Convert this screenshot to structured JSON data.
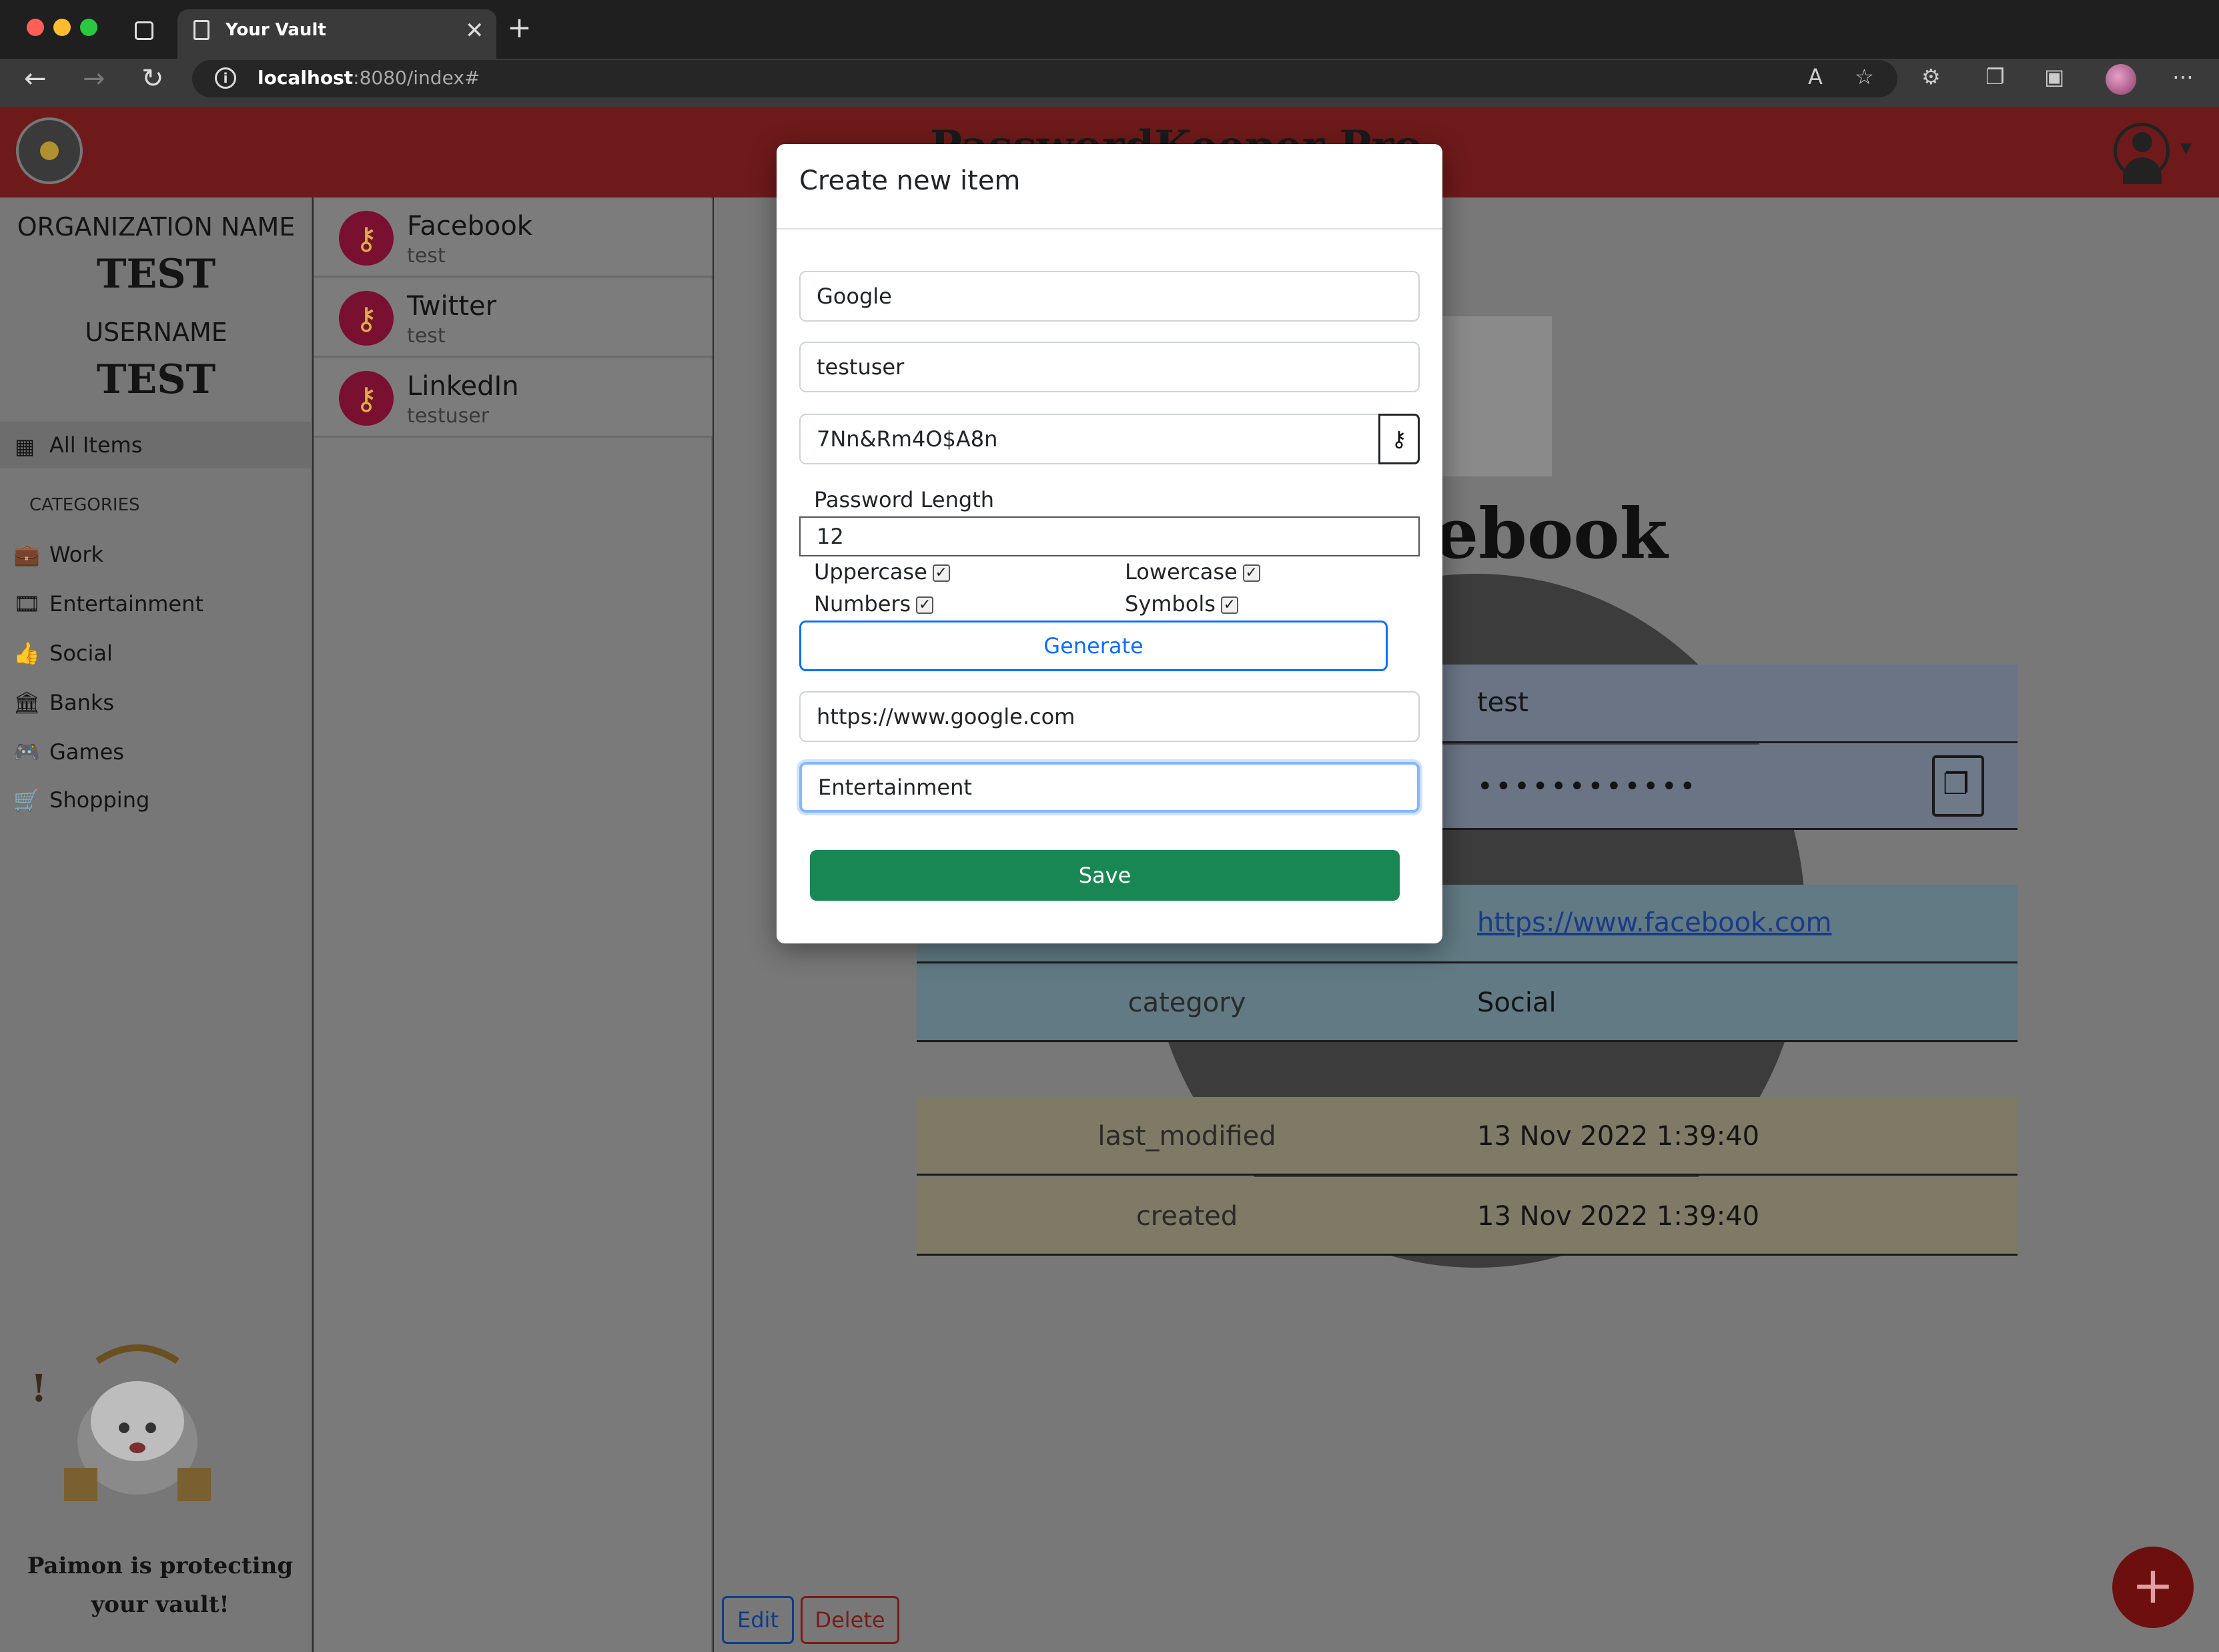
{
  "browser": {
    "tab_title": "Your Vault",
    "url_host": "localhost",
    "url_rest": ":8080/index#"
  },
  "app": {
    "brand": "PasswordKeeper Pro",
    "icons": {
      "logo": "vault-logo",
      "user": "user-circle-icon"
    }
  },
  "sidebar": {
    "org_label": "ORGANIZATION NAME",
    "org_value": "TEST",
    "user_label": "USERNAME",
    "user_value": "TEST",
    "all_items": "All Items",
    "categories_heading": "CATEGORIES",
    "categories": [
      {
        "label": "Work",
        "icon": "briefcase-icon",
        "glyph": "💼"
      },
      {
        "label": "Entertainment",
        "icon": "film-icon",
        "glyph": "🎞"
      },
      {
        "label": "Social",
        "icon": "thumbs-up-icon",
        "glyph": "👍"
      },
      {
        "label": "Banks",
        "icon": "bank-icon",
        "glyph": "🏛"
      },
      {
        "label": "Games",
        "icon": "gamepad-icon",
        "glyph": "🎮"
      },
      {
        "label": "Shopping",
        "icon": "cart-icon",
        "glyph": "🛒"
      }
    ],
    "caption_line1": "Paimon is protecting",
    "caption_line2": "your vault!"
  },
  "items": [
    {
      "name": "Facebook",
      "user": "test"
    },
    {
      "name": "Twitter",
      "user": "test"
    },
    {
      "name": "LinkedIn",
      "user": "testuser"
    }
  ],
  "details": {
    "title": "ebook",
    "username_value": "test",
    "password_value": "••••••••••••",
    "url_value": "https://www.facebook.com",
    "category_key": "category",
    "category_value": "Social",
    "last_modified_key": "last_modified",
    "last_modified_value": "13 Nov 2022 1:39:40",
    "created_key": "created",
    "created_value": "13 Nov 2022 1:39:40",
    "edit_label": "Edit",
    "delete_label": "Delete",
    "fab_label": "+"
  },
  "modal": {
    "title": "Create new item",
    "name_value": "Google",
    "username_value": "testuser",
    "password_value": "7Nn&Rm4O$A8n",
    "password_length_label": "Password Length",
    "password_length_value": "12",
    "uppercase_label": "Uppercase",
    "lowercase_label": "Lowercase",
    "numbers_label": "Numbers",
    "symbols_label": "Symbols",
    "generate_label": "Generate",
    "url_value": "https://www.google.com",
    "category_value": "Entertainment",
    "save_label": "Save"
  },
  "colors": {
    "header": "#6e1a1a",
    "save": "#198754",
    "generate": "#0d6efd"
  }
}
